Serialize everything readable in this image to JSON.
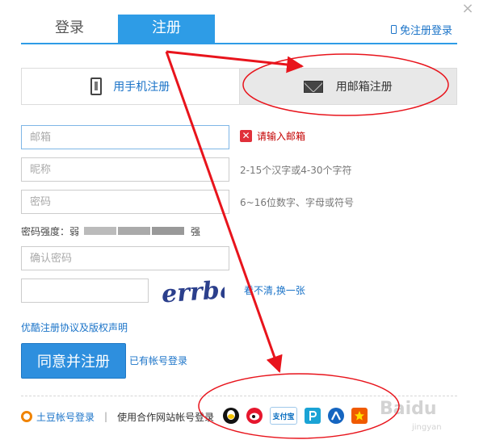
{
  "window": {
    "close_glyph": "×"
  },
  "tabs": {
    "login_label": "登录",
    "register_label": "注册"
  },
  "free_register_label": "免注册登录",
  "methods": {
    "phone_label": "用手机注册",
    "email_label": "用邮箱注册"
  },
  "form": {
    "email_placeholder": "邮箱",
    "email_error": "请输入邮箱",
    "nickname_placeholder": "昵称",
    "nickname_hint": "2-15个汉字或4-30个字符",
    "password_placeholder": "密码",
    "password_hint": "6~16位数字、字母或符号",
    "strength_label": "密码强度：弱",
    "strength_strong_label": "强",
    "confirm_placeholder": "确认密码",
    "captcha_value": "",
    "captcha_text": "errbq",
    "captcha_refresh_label": "看不清,换一张",
    "agreement_link": "优酷注册协议及版权声明",
    "submit_label": "同意并注册",
    "has_account_link": "已有帐号登录"
  },
  "footer": {
    "tudou_link": "土豆帐号登录",
    "separator": "|",
    "partner_text": "使用合作网站帐号登录",
    "partner_icons": [
      "qq-icon",
      "weibo-icon",
      "alipay-icon",
      "pptv-icon",
      "renren-icon",
      "star-icon"
    ],
    "alipay_label": "支付宝"
  },
  "watermark": {
    "text": "Baidu",
    "sub": "jingyan"
  },
  "colors": {
    "accent": "#2e9ce6",
    "link": "#1a73c8",
    "error": "#c40000",
    "annotation": "#e8141c"
  }
}
